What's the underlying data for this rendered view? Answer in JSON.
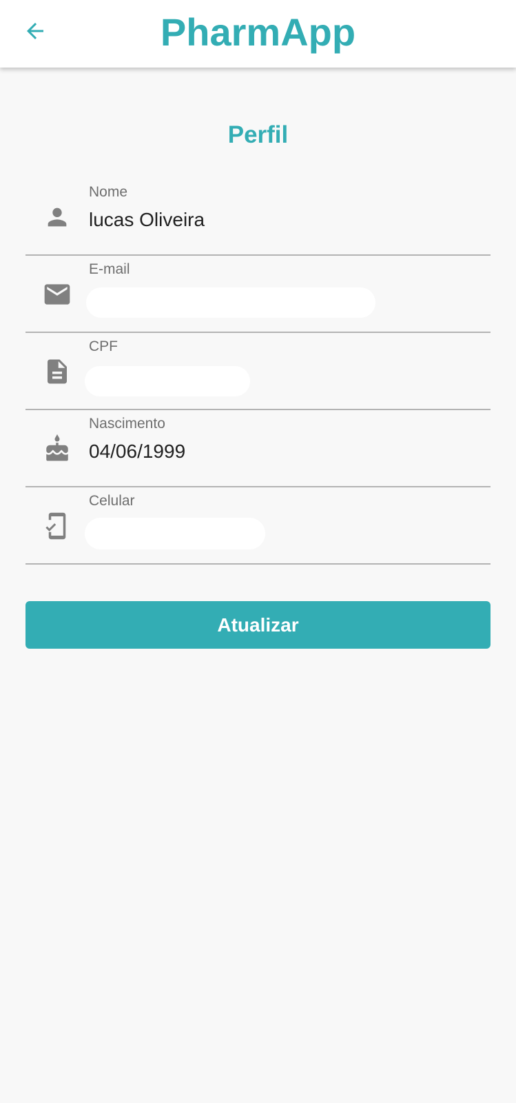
{
  "app": {
    "title": "PharmApp",
    "accent_color": "#33adb4"
  },
  "header": {
    "back_icon": "arrow-back-icon"
  },
  "page": {
    "title": "Perfil"
  },
  "fields": [
    {
      "icon": "person-icon",
      "label": "Nome",
      "value": "lucas Oliveira"
    },
    {
      "icon": "mail-icon",
      "label": "E-mail",
      "value": ""
    },
    {
      "icon": "document-icon",
      "label": "CPF",
      "value": ""
    },
    {
      "icon": "cake-icon",
      "label": "Nascimento",
      "value": "04/06/1999"
    },
    {
      "icon": "phone-check-icon",
      "label": "Celular",
      "value": ""
    }
  ],
  "actions": {
    "update_label": "Atualizar"
  }
}
